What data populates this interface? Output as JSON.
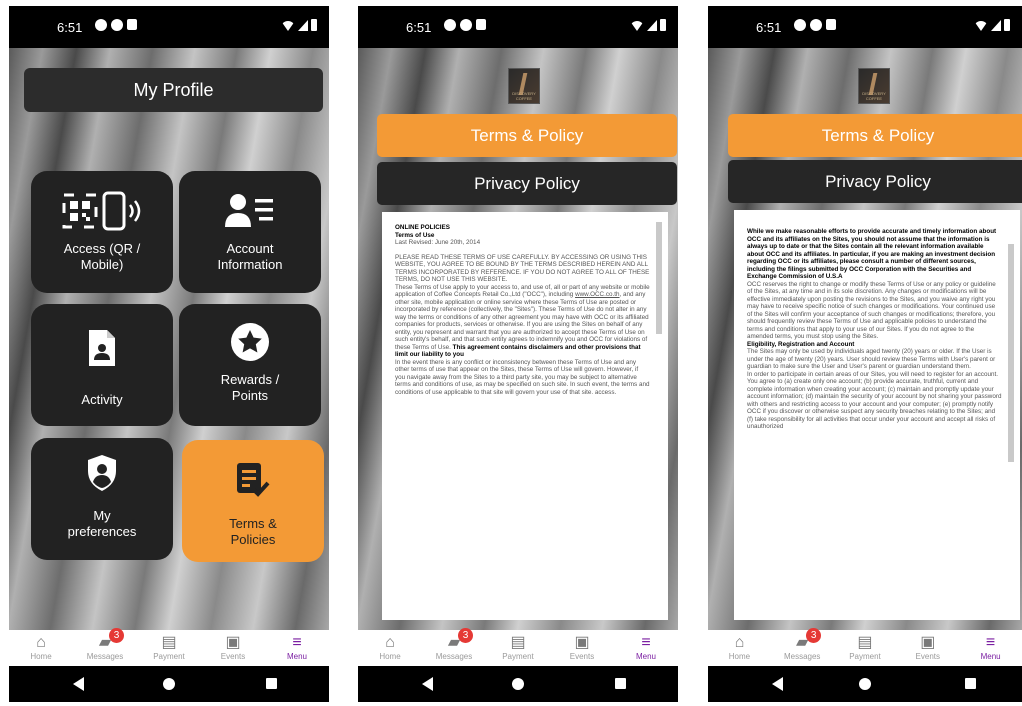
{
  "status": {
    "time": "6:51"
  },
  "tabs": [
    {
      "label": "Home",
      "icon": "home-icon",
      "glyph": "⌂",
      "active": false
    },
    {
      "label": "Messages",
      "icon": "chat-icon",
      "glyph": "▰",
      "badge": "3",
      "active": false
    },
    {
      "label": "Payment",
      "icon": "payment-icon",
      "glyph": "▤",
      "active": false
    },
    {
      "label": "Events",
      "icon": "calendar-icon",
      "glyph": "▣",
      "active": false
    },
    {
      "label": "Menu",
      "icon": "menu-icon",
      "glyph": "≡",
      "active": true
    }
  ],
  "screen1": {
    "title": "My Profile",
    "tiles": [
      {
        "line1": "Access (QR /",
        "line2": "Mobile)",
        "icon": "qr-mobile-icon"
      },
      {
        "line1": "Account",
        "line2": "Information",
        "icon": "account-list-icon"
      },
      {
        "line1": "Activity",
        "line2": "",
        "icon": "document-person-icon"
      },
      {
        "line1": "Rewards /",
        "line2": "Points",
        "icon": "star-icon"
      },
      {
        "line1": "My",
        "line2": "preferences",
        "icon": "shield-person-icon"
      },
      {
        "line1": "Terms &",
        "line2": "Policies",
        "icon": "policy-check-icon"
      }
    ]
  },
  "policy": {
    "logo_text": "DISCOVERY COFFEE",
    "terms_label": "Terms & Policy",
    "privacy_label": "Privacy Policy"
  },
  "doc1": {
    "h1": "ONLINE POLICIES",
    "h2": "Terms of Use",
    "revised": "Last Revised: June 20th, 2014",
    "p1": "PLEASE READ THESE TERMS OF USE CAREFULLY. BY ACCESSING OR USING THIS WEBSITE, YOU AGREE TO BE BOUND BY THE TERMS DESCRIBED HEREIN AND ALL TERMS INCORPORATED BY REFERENCE. IF YOU DO NOT AGREE TO ALL OF THESE TERMS, DO NOT USE THIS WEBSITE.",
    "p2a": "These Terms of Use apply to your access to, and use of, all or part of any website or mobile application of Coffee Concepts Retail Co.,Ltd (\"OCC\"), including ",
    "p2link": "www.OCC.co.th",
    "p2b": ", and any other site, mobile application or online service where these Terms of Use are posted or incorporated by reference (collectively, the \"Sites\"). These Terms of Use do not alter in any way the terms or conditions of any other agreement you may have with OCC or its affiliated companies for products, services or otherwise. If you are using the Sites on behalf of any entity, you represent and warrant that you are authorized to accept these Terms of Use on such entity's behalf, and that such entity agrees to indemnify you and OCC for violations of these Terms of Use. ",
    "p2bold": "This agreement contains disclaimers and other provisions that limit our liability to you",
    "p3": "In the event there is any conflict or inconsistency between these Terms of Use and any other terms of use that appear on the Sites, these Terms of Use will govern. However, if you navigate away from the Sites to a third party site, you may be subject to alternative terms and conditions of use, as may be specified on such site. In such event, the terms and conditions of use applicable to that site will govern your use of that site. access."
  },
  "doc3": {
    "pbold": "While we make reasonable efforts to provide accurate and timely information about OCC and its affiliates on the Sites, you should not assume that the information is always up to date or that the Sites contain all the relevant information available about OCC and its affiliates. In particular, if you are making an investment decision regarding OCC or its affiliates, please consult a number of different sources, including the filings submitted by OCC Corporation with the Securities and Exchange Commission of U.S.A",
    "p1": "OCC reserves the right to change or modify these Terms of Use or any policy or guideline of the Sites, at any time and in its sole discretion. Any changes or modifications will be effective immediately upon posting the revisions to the Sites, and you waive any right you may have to receive specific notice of such changes or modifications. Your continued use of the Sites will confirm your acceptance of such changes or modifications; therefore, you should frequently review these Terms of Use and applicable policies to understand the terms and conditions that apply to your use of our Sites. If you do not agree to the amended terms, you must stop using the Sites.",
    "h": "Eligibility, Registration and Account",
    "p2": "The Sites may only be used by individuals aged twenty (20) years or older. If the User is under the age of twenty (20) years. User should review these Terms with User's parent or guardian to make sure the User and User's parent or guardian understand them.",
    "p3": "In order to participate in certain areas of our Sites, you will need to register for an account. You agree to (a) create only one account; (b) provide accurate, truthful, current and complete information when creating your account; (c) maintain and promptly update your account information; (d) maintain the security of your account by not sharing your password with others and restricting access to your account and your computer; (e) promptly notify OCC if you discover or otherwise suspect any security breaches relating to the Sites; and (f) take responsibility for all activities that occur under your account and accept all risks of unauthorized"
  }
}
